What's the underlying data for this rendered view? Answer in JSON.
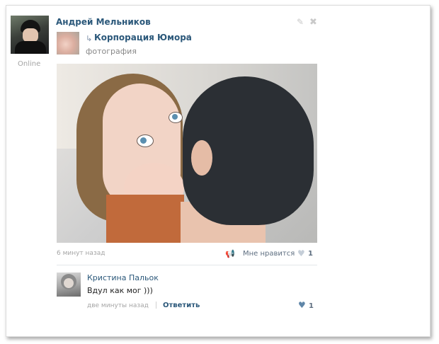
{
  "post": {
    "author": "Андрей Мельников",
    "status": "Online",
    "edit_icon": "✎",
    "close_icon": "✖",
    "repost": {
      "arrow_icon": "↳",
      "source": "Корпорация Юмора",
      "verified_icon": "✓",
      "subtitle": "фотография"
    },
    "time": "6 минут назад",
    "share_icon": "📢",
    "like_label": "Мне нравится",
    "like_icon": "♥",
    "like_count": "1"
  },
  "comment": {
    "author": "Кристина Пальок",
    "text": "Вдул как мог )))",
    "time": "две минуты назад",
    "reply_label": "Ответить",
    "like_icon": "♥",
    "like_count": "1"
  },
  "colors": {
    "link": "#2b587a",
    "muted": "#a5a5a5",
    "like_active": "#5f86a8"
  }
}
